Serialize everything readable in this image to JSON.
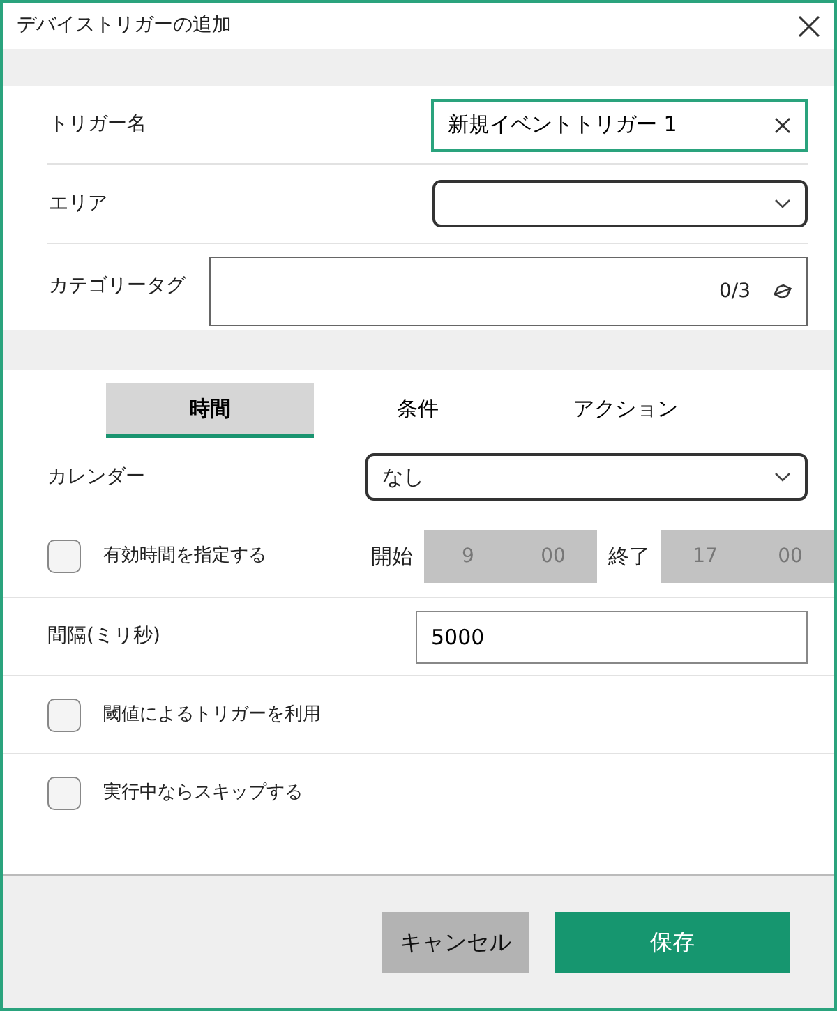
{
  "window": {
    "title": "デバイストリガーの追加"
  },
  "fields": [
    {
      "kind": "text",
      "label": "トリガー名",
      "value": "新規イベントトリガー 1",
      "focused": true
    },
    {
      "kind": "select",
      "label": "エリア"
    },
    {
      "kind": "tags",
      "label": "カテゴリータグ",
      "count": "0/3"
    }
  ],
  "tabs": [
    {
      "label": "時間",
      "selected": true
    },
    {
      "label": "条件",
      "selected": false
    },
    {
      "label": "アクション",
      "selected": false
    }
  ],
  "calendar": {
    "label": "カレンダー",
    "value": "なし"
  },
  "valid_time": {
    "label": "有効時間を指定する",
    "checked": false,
    "start_label": "開始",
    "start_hour": "9",
    "start_minute": "00",
    "end_label": "終了",
    "end_hour": "17",
    "end_minute": "00"
  },
  "interval": {
    "label": "間隔(ミリ秒)",
    "value": "5000"
  },
  "options": [
    {
      "label": "閾値によるトリガーを利用",
      "checked": false
    },
    {
      "label": "実行中ならスキップする",
      "checked": false
    }
  ],
  "buttons": [
    {
      "kind": "secondary",
      "label": "キャンセル"
    },
    {
      "kind": "primary",
      "label": "保存"
    }
  ]
}
